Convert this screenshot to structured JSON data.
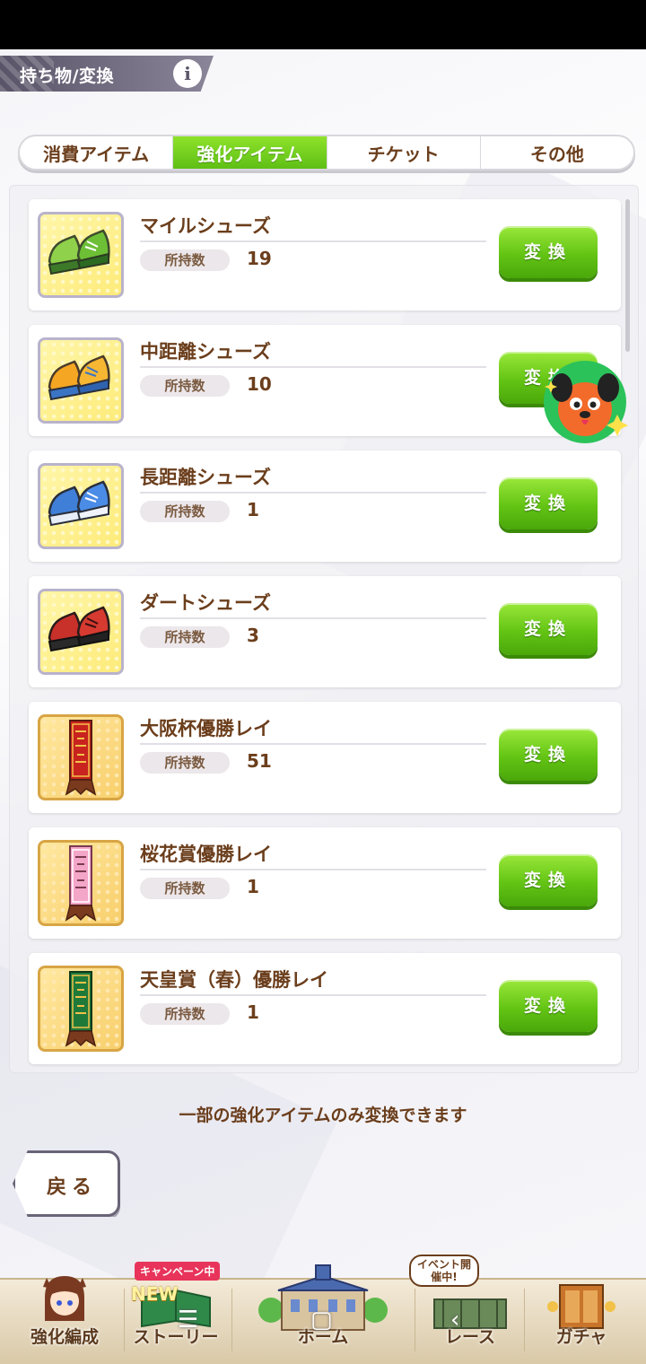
{
  "header": {
    "title": "持ち物/変換",
    "info_icon": "i"
  },
  "tabs": [
    {
      "label": "消費アイテム",
      "active": false
    },
    {
      "label": "強化アイテム",
      "active": true
    },
    {
      "label": "チケット",
      "active": false
    },
    {
      "label": "その他",
      "active": false
    }
  ],
  "items": [
    {
      "name": "マイルシューズ",
      "qty_label": "所持数",
      "qty": "19",
      "button": "変換",
      "icon": "green-shoes-icon"
    },
    {
      "name": "中距離シューズ",
      "qty_label": "所持数",
      "qty": "10",
      "button": "変換",
      "icon": "orange-shoes-icon"
    },
    {
      "name": "長距離シューズ",
      "qty_label": "所持数",
      "qty": "1",
      "button": "変換",
      "icon": "blue-shoes-icon"
    },
    {
      "name": "ダートシューズ",
      "qty_label": "所持数",
      "qty": "3",
      "button": "変換",
      "icon": "red-shoes-icon"
    },
    {
      "name": "大阪杯優勝レイ",
      "qty_label": "所持数",
      "qty": "51",
      "button": "変換",
      "icon": "red-lei-icon"
    },
    {
      "name": "桜花賞優勝レイ",
      "qty_label": "所持数",
      "qty": "1",
      "button": "変換",
      "icon": "pink-lei-icon"
    },
    {
      "name": "天皇賞（春）優勝レイ",
      "qty_label": "所持数",
      "qty": "1",
      "button": "変換",
      "icon": "green-lei-icon"
    }
  ],
  "note": "一部の強化アイテムのみ変換できます",
  "back_button": "戻る",
  "bottom_nav": {
    "items": [
      {
        "label": "強化編成",
        "icon": "character-icon"
      },
      {
        "label": "ストーリー",
        "icon": "story-book-icon",
        "badge": "キャンペーン中",
        "new": "NEW"
      },
      {
        "label": "ホーム",
        "icon": "home-building-icon"
      },
      {
        "label": "レース",
        "icon": "race-gate-icon",
        "badge": "イベント開催中!"
      },
      {
        "label": "ガチャ",
        "icon": "gacha-gate-icon"
      }
    ]
  },
  "colors": {
    "accent_green": "#63c414",
    "text_brown": "#6b3e1c",
    "header_purple": "#5a5468"
  }
}
